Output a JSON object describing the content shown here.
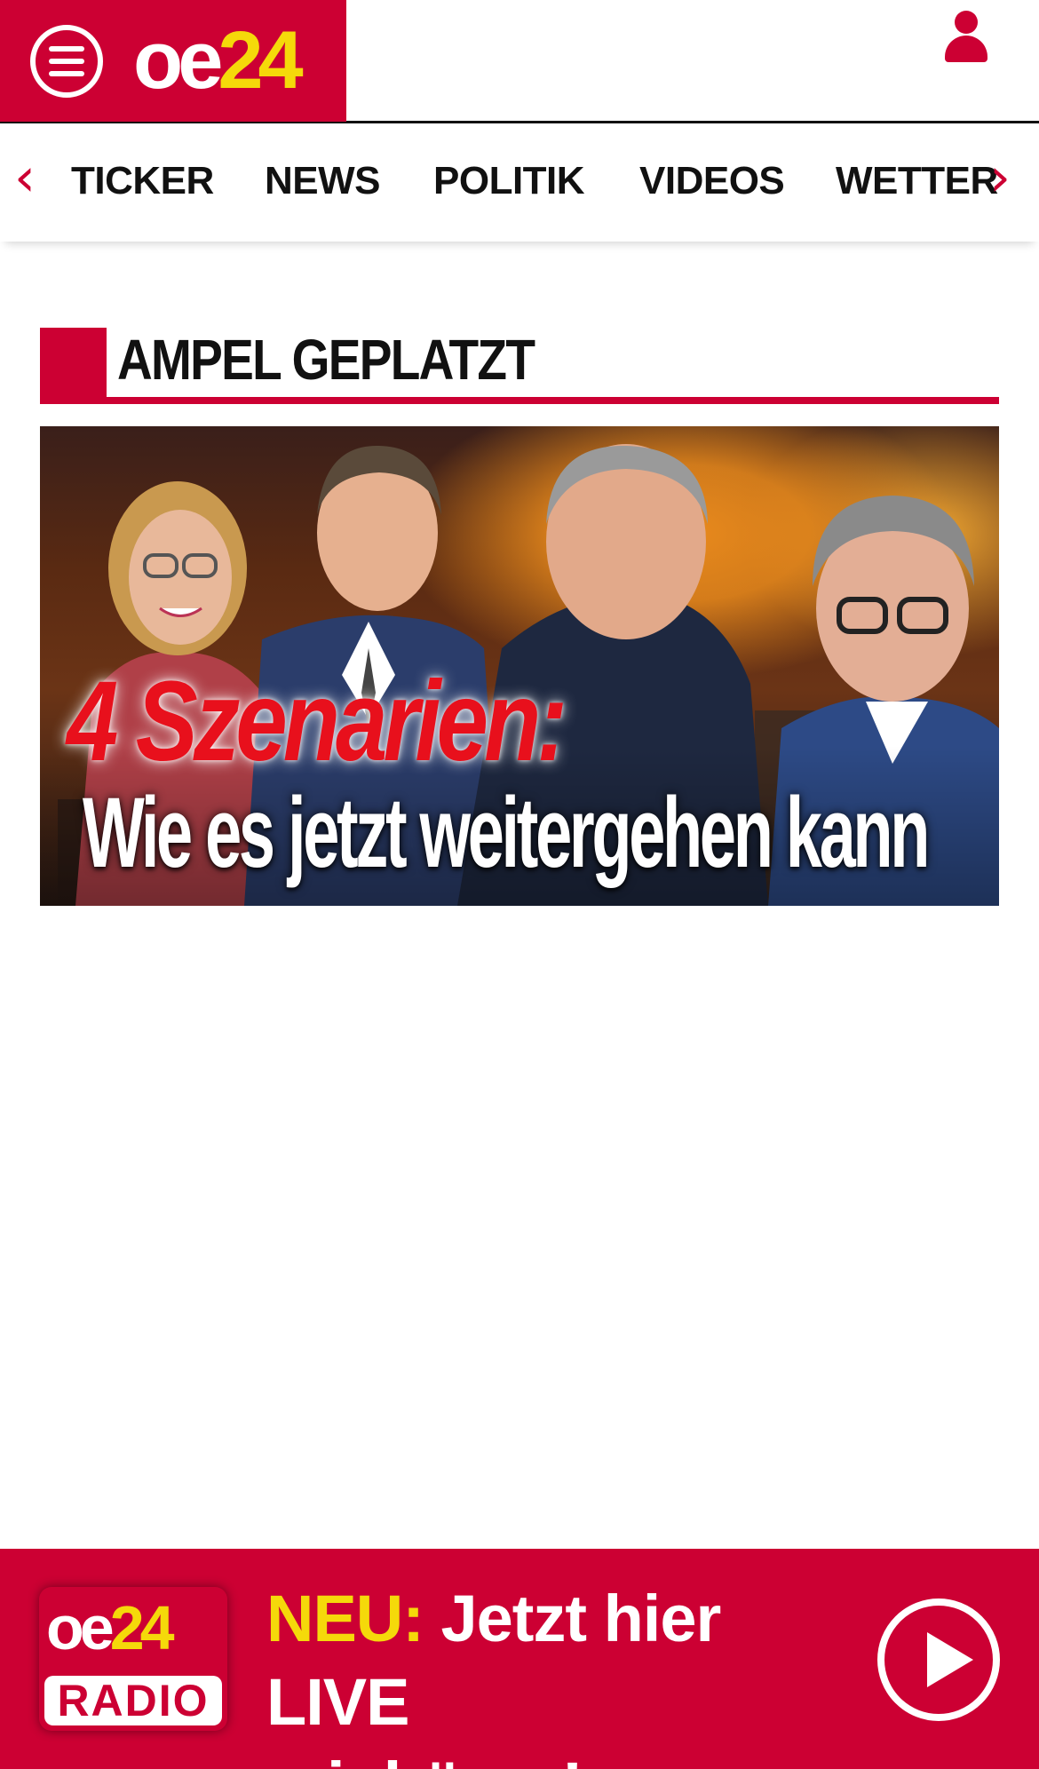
{
  "header": {
    "logo_oe": "oe",
    "logo_num": "24",
    "menu_icon": "hamburger-menu-icon",
    "user_icon": "user-icon"
  },
  "nav": {
    "items": [
      {
        "label": "TICKER"
      },
      {
        "label": "NEWS"
      },
      {
        "label": "POLITIK"
      },
      {
        "label": "VIDEOS"
      },
      {
        "label": "WETTER"
      }
    ],
    "prev_icon": "chevron-left-icon",
    "next_icon": "chevron-right-icon"
  },
  "section": {
    "title": "AMPEL GEPLATZT"
  },
  "hero": {
    "headline_line1": "4 Szenarien:",
    "headline_line2": "Wie es jetzt weitergehen kann"
  },
  "radio_banner": {
    "logo_oe": "oe",
    "logo_num": "24",
    "logo_label": "RADIO",
    "neu": "NEU:",
    "text_line1": "Jetzt hier",
    "text_line2": "LIVE reinhören!",
    "play_icon": "play-icon"
  },
  "colors": {
    "brand_red": "#cc0033",
    "logo_yellow": "#f5d90a",
    "headline_red": "#e8101c"
  }
}
